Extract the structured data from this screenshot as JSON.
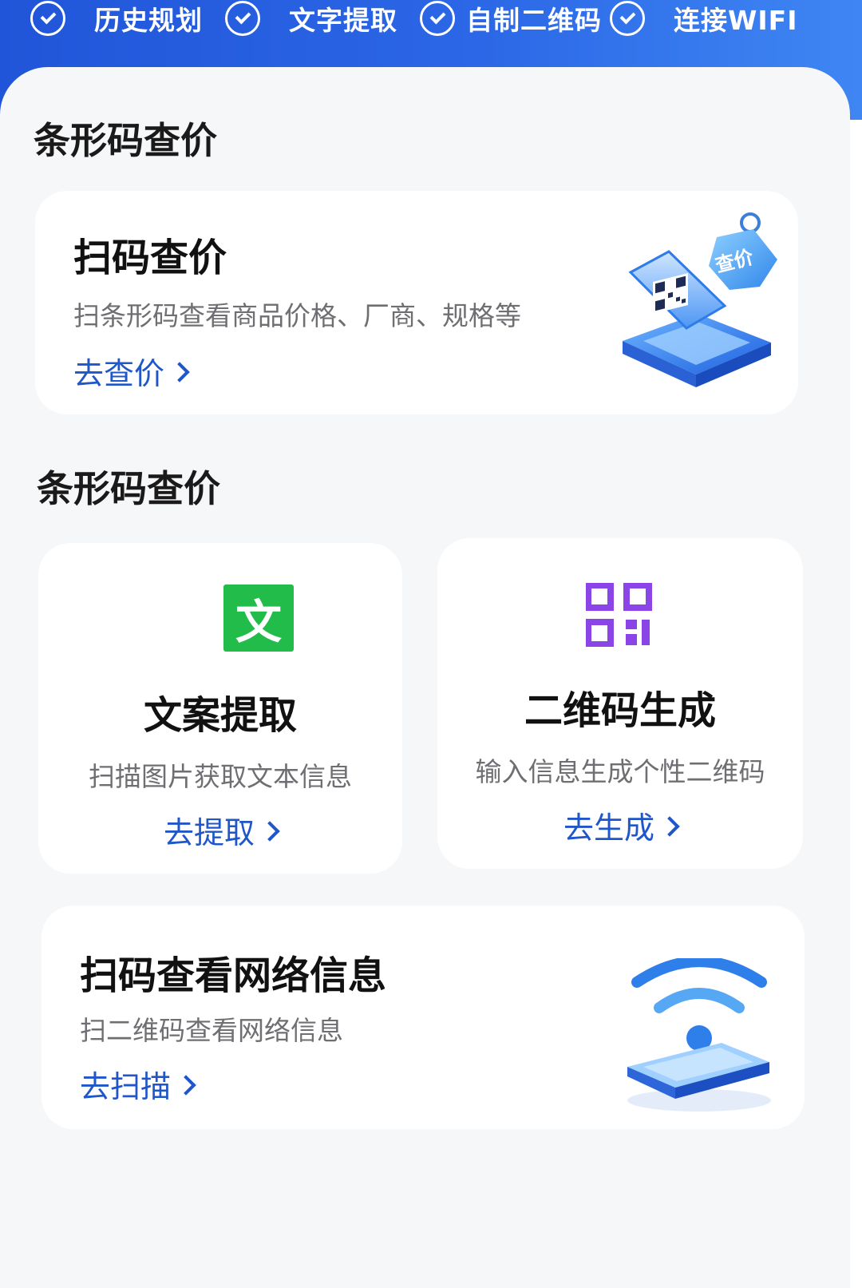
{
  "top_features": [
    {
      "label": "历史规划",
      "icon": "check-circle-icon"
    },
    {
      "label": "文字提取",
      "icon": "check-circle-icon"
    },
    {
      "label": "自制二维码",
      "icon": "check-circle-icon"
    },
    {
      "label": "连接WIFI",
      "icon": "check-circle-icon"
    }
  ],
  "sections": [
    {
      "title": "条形码查价"
    },
    {
      "title": "条形码查价"
    }
  ],
  "scan_price_card": {
    "title": "扫码查价",
    "description": "扫条形码查看商品价格、厂商、规格等",
    "action": "去查价",
    "tag_text": "查价"
  },
  "text_extract_card": {
    "icon_char": "文",
    "title": "文案提取",
    "description": "扫描图片获取文本信息",
    "action": "去提取"
  },
  "qr_generate_card": {
    "title": "二维码生成",
    "description": "输入信息生成个性二维码",
    "action": "去生成"
  },
  "network_card": {
    "title": "扫码查看网络信息",
    "description": "扫二维码查看网络信息",
    "action": "去扫描"
  },
  "colors": {
    "header_gradient_start": "#2155d9",
    "header_gradient_end": "#3f86f3",
    "link": "#1f56c9",
    "green_icon": "#21bc4a",
    "purple_icon": "#8b45e6",
    "background": "#f6f7f9"
  }
}
